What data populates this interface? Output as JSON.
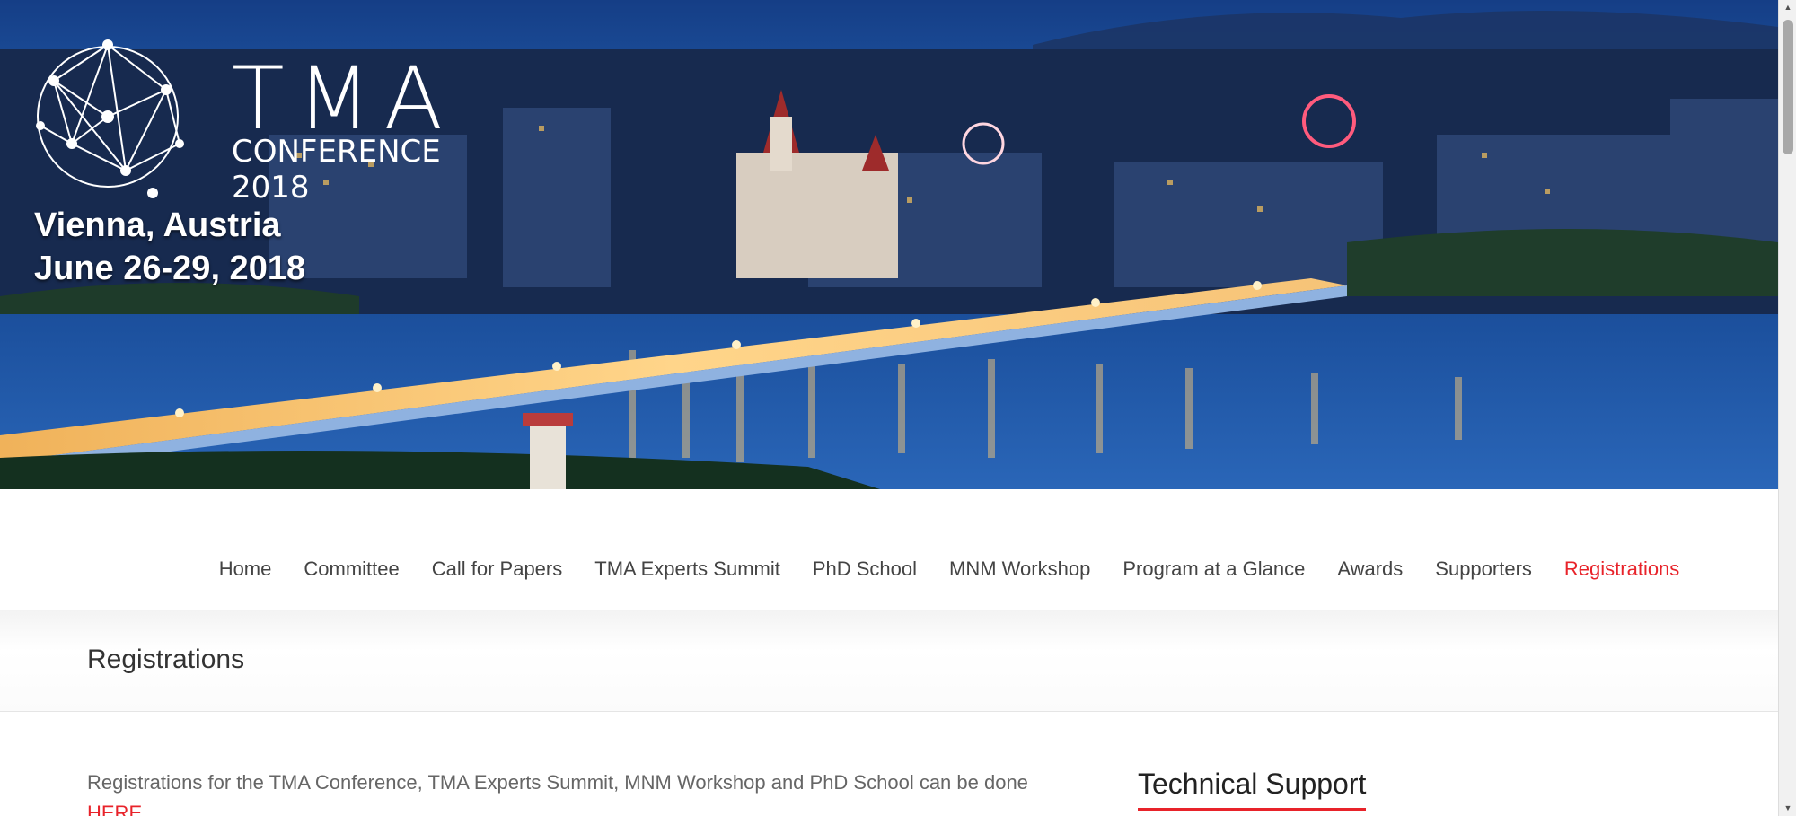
{
  "banner": {
    "logo_word": "TMA",
    "logo_sub": "CONFERENCE",
    "logo_year": "2018",
    "location": "Vienna, Austria",
    "dates": "June 26-29, 2018"
  },
  "nav": {
    "items": [
      {
        "label": "Home"
      },
      {
        "label": "Committee"
      },
      {
        "label": "Call for Papers"
      },
      {
        "label": "TMA Experts Summit"
      },
      {
        "label": "PhD School"
      },
      {
        "label": "MNM Workshop"
      },
      {
        "label": "Program at a Glance"
      },
      {
        "label": "Awards"
      },
      {
        "label": "Supporters"
      },
      {
        "label": "Registrations"
      }
    ],
    "active_index": 9
  },
  "page": {
    "title": "Registrations"
  },
  "content": {
    "intro_text": "Registrations for the TMA Conference, TMA Experts Summit, MNM Workshop and PhD School can be done",
    "here_link": "HERE"
  },
  "sidebar": {
    "title": "Technical Support"
  },
  "colors": {
    "accent": "#e8232a",
    "nav_text": "#444444",
    "body_text": "#666666"
  }
}
